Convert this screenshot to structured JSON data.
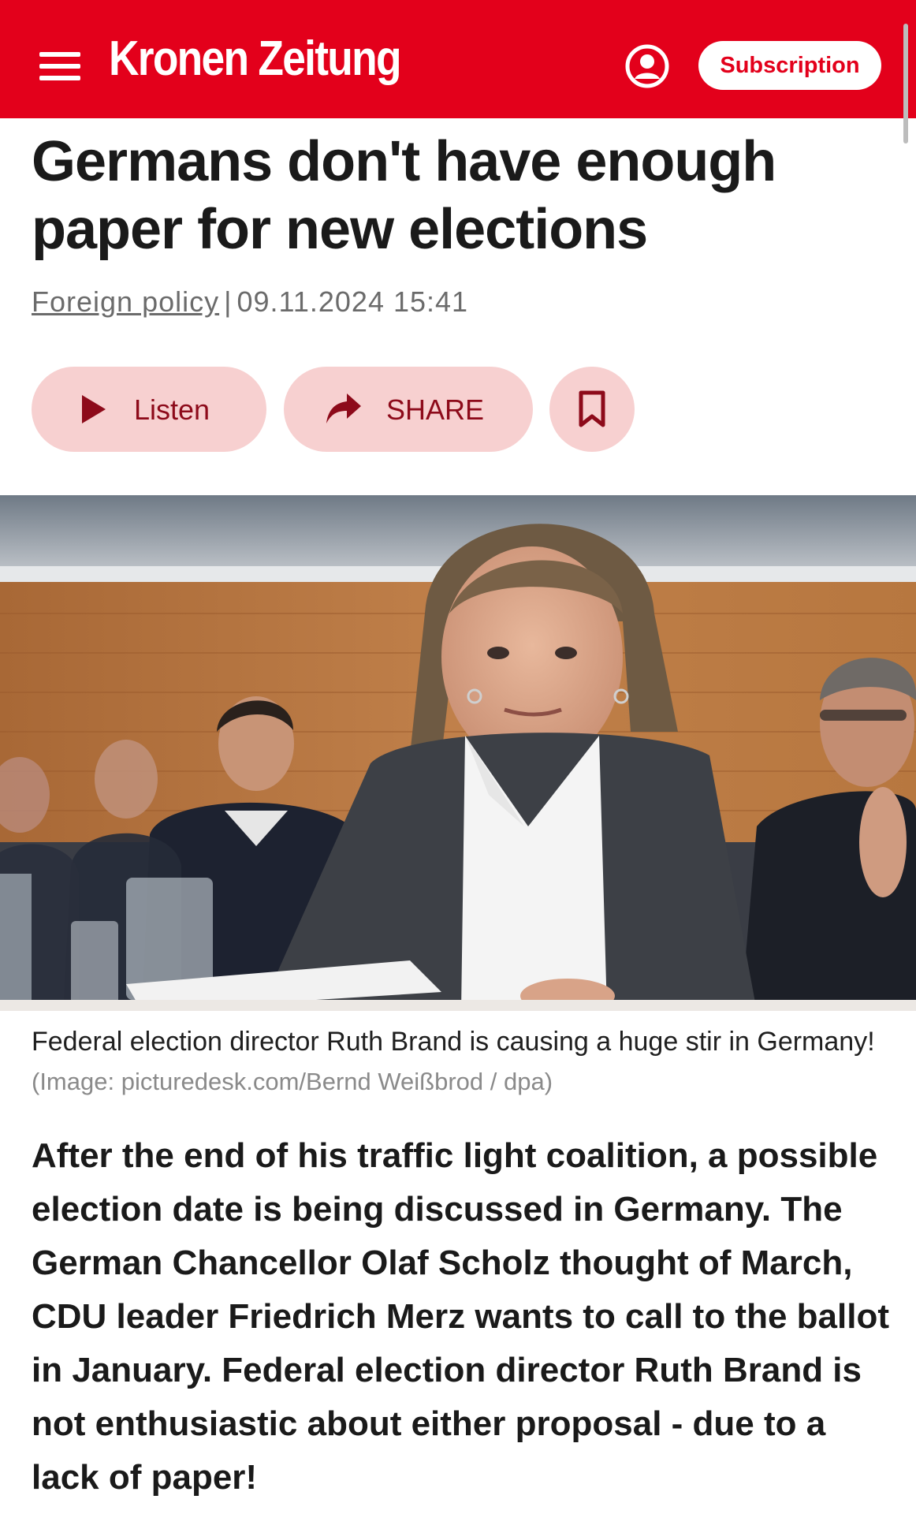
{
  "header": {
    "logo_text": "Kronen Zeitung",
    "subscription_label": "Subscription",
    "brand_color": "#e3001b"
  },
  "article": {
    "headline": "Germans don't have enough paper for new elections",
    "section": "Foreign policy",
    "separator": "|",
    "datetime": "09.11.2024 15:41",
    "actions": {
      "listen_label": "Listen",
      "share_label": "SHARE"
    },
    "image": {
      "caption": "Federal election director Ruth Brand is causing a huge stir in Germany!",
      "credit": "(Image: picturedesk.com/Bernd Weißbrod / dpa)"
    },
    "lead": "After the end of his traffic light coalition, a possible election date is being discussed in Germany. The German Chancellor Olaf Scholz thought of March, CDU leader Friedrich Merz wants to call to the ballot in January. Federal election director Ruth Brand is not enthusiastic about either proposal - due to a lack of paper!"
  },
  "icons": [
    "menu-icon",
    "user-account-icon",
    "play-icon",
    "share-arrow-icon",
    "bookmark-icon"
  ]
}
